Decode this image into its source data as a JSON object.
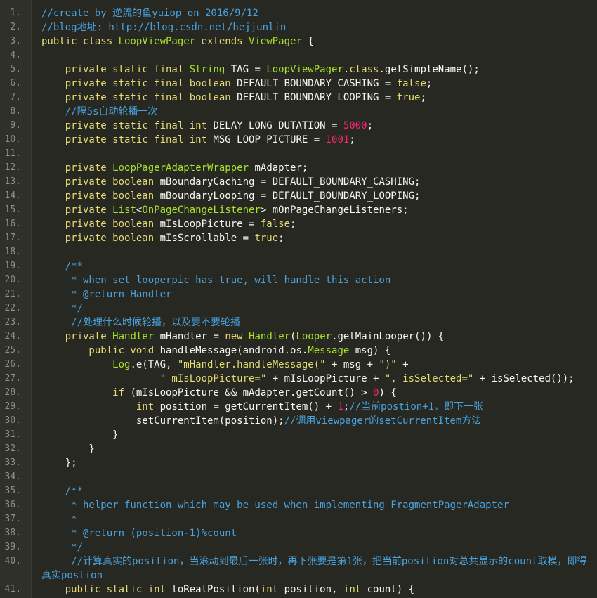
{
  "editor": {
    "theme_colors": {
      "background": "#272822",
      "gutter": "#2f302a",
      "comment": "#4aa3df",
      "keyword": "#e6db74",
      "type": "#a6e22e",
      "string": "#e6db74",
      "number": "#f92672",
      "plain": "#f8f8f2"
    },
    "lines": [
      {
        "n": "1.",
        "segs": [
          {
            "c": "comment",
            "t": "//create by 逆流的鱼yuiop on 2016/9/12"
          }
        ]
      },
      {
        "n": "2.",
        "segs": [
          {
            "c": "comment",
            "t": "//blog地址: http://blog.csdn.net/hejjunlin"
          }
        ]
      },
      {
        "n": "3.",
        "segs": [
          {
            "c": "kw",
            "t": "public class "
          },
          {
            "c": "ty",
            "t": "LoopViewPager"
          },
          {
            "c": "kw",
            "t": " extends "
          },
          {
            "c": "ty",
            "t": "ViewPager"
          },
          {
            "c": "pl",
            "t": " {"
          }
        ]
      },
      {
        "n": "4.",
        "segs": []
      },
      {
        "n": "5.",
        "segs": [
          {
            "c": "kw",
            "t": "    private static final "
          },
          {
            "c": "ty",
            "t": "String"
          },
          {
            "c": "pl",
            "t": " TAG = "
          },
          {
            "c": "ty",
            "t": "LoopViewPager"
          },
          {
            "c": "pl",
            "t": "."
          },
          {
            "c": "kw",
            "t": "class"
          },
          {
            "c": "pl",
            "t": ".getSimpleName();"
          }
        ]
      },
      {
        "n": "6.",
        "segs": [
          {
            "c": "kw",
            "t": "    private static final boolean"
          },
          {
            "c": "pl",
            "t": " DEFAULT_BOUNDARY_CASHING = "
          },
          {
            "c": "kw",
            "t": "false"
          },
          {
            "c": "pl",
            "t": ";"
          }
        ]
      },
      {
        "n": "7.",
        "segs": [
          {
            "c": "kw",
            "t": "    private static final boolean"
          },
          {
            "c": "pl",
            "t": " DEFAULT_BOUNDARY_LOOPING = "
          },
          {
            "c": "kw",
            "t": "true"
          },
          {
            "c": "pl",
            "t": ";"
          }
        ]
      },
      {
        "n": "8.",
        "segs": [
          {
            "c": "comment",
            "t": "    //隔5s自动轮播一次"
          }
        ]
      },
      {
        "n": "9.",
        "segs": [
          {
            "c": "kw",
            "t": "    private static final int"
          },
          {
            "c": "pl",
            "t": " DELAY_LONG_DUTATION = "
          },
          {
            "c": "num",
            "t": "5000"
          },
          {
            "c": "pl",
            "t": ";"
          }
        ]
      },
      {
        "n": "10.",
        "segs": [
          {
            "c": "kw",
            "t": "    private static final int"
          },
          {
            "c": "pl",
            "t": " MSG_LOOP_PICTURE = "
          },
          {
            "c": "num",
            "t": "1001"
          },
          {
            "c": "pl",
            "t": ";"
          }
        ]
      },
      {
        "n": "11.",
        "segs": []
      },
      {
        "n": "12.",
        "segs": [
          {
            "c": "kw",
            "t": "    private "
          },
          {
            "c": "ty",
            "t": "LoopPagerAdapterWrapper"
          },
          {
            "c": "pl",
            "t": " mAdapter;"
          }
        ]
      },
      {
        "n": "13.",
        "segs": [
          {
            "c": "kw",
            "t": "    private boolean"
          },
          {
            "c": "pl",
            "t": " mBoundaryCaching = DEFAULT_BOUNDARY_CASHING;"
          }
        ]
      },
      {
        "n": "14.",
        "segs": [
          {
            "c": "kw",
            "t": "    private boolean"
          },
          {
            "c": "pl",
            "t": " mBoundaryLooping = DEFAULT_BOUNDARY_LOOPING;"
          }
        ]
      },
      {
        "n": "15.",
        "segs": [
          {
            "c": "kw",
            "t": "    private "
          },
          {
            "c": "ty",
            "t": "List"
          },
          {
            "c": "pl",
            "t": "<"
          },
          {
            "c": "ty",
            "t": "OnPageChangeListener"
          },
          {
            "c": "pl",
            "t": "> mOnPageChangeListeners;"
          }
        ]
      },
      {
        "n": "16.",
        "segs": [
          {
            "c": "kw",
            "t": "    private boolean"
          },
          {
            "c": "pl",
            "t": " mIsLoopPicture = "
          },
          {
            "c": "kw",
            "t": "false"
          },
          {
            "c": "pl",
            "t": ";"
          }
        ]
      },
      {
        "n": "17.",
        "segs": [
          {
            "c": "kw",
            "t": "    private boolean"
          },
          {
            "c": "pl",
            "t": " mIsScrollable = "
          },
          {
            "c": "kw",
            "t": "true"
          },
          {
            "c": "pl",
            "t": ";"
          }
        ]
      },
      {
        "n": "18.",
        "segs": []
      },
      {
        "n": "19.",
        "segs": [
          {
            "c": "comment",
            "t": "    /**"
          }
        ]
      },
      {
        "n": "20.",
        "segs": [
          {
            "c": "comment",
            "t": "     * when set looperpic has true, will handle this action"
          }
        ]
      },
      {
        "n": "21.",
        "segs": [
          {
            "c": "comment",
            "t": "     * @return Handler"
          }
        ]
      },
      {
        "n": "22.",
        "segs": [
          {
            "c": "comment",
            "t": "     */"
          }
        ]
      },
      {
        "n": "23.",
        "segs": [
          {
            "c": "comment",
            "t": "     //处理什么时候轮播，以及要不要轮播"
          }
        ]
      },
      {
        "n": "24.",
        "segs": [
          {
            "c": "kw",
            "t": "    private "
          },
          {
            "c": "ty",
            "t": "Handler"
          },
          {
            "c": "pl",
            "t": " mHandler = "
          },
          {
            "c": "kw",
            "t": "new "
          },
          {
            "c": "ty",
            "t": "Handler"
          },
          {
            "c": "pl",
            "t": "("
          },
          {
            "c": "ty",
            "t": "Looper"
          },
          {
            "c": "pl",
            "t": ".getMainLooper()) {"
          }
        ]
      },
      {
        "n": "25.",
        "segs": [
          {
            "c": "kw",
            "t": "        public void"
          },
          {
            "c": "pl",
            "t": " handleMessage(android.os."
          },
          {
            "c": "ty",
            "t": "Message"
          },
          {
            "c": "pl",
            "t": " msg) {"
          }
        ]
      },
      {
        "n": "26.",
        "segs": [
          {
            "c": "ty",
            "t": "            Log"
          },
          {
            "c": "pl",
            "t": ".e(TAG, "
          },
          {
            "c": "str",
            "t": "\"mHandler.handleMessage(\""
          },
          {
            "c": "pl",
            "t": " + msg + "
          },
          {
            "c": "str",
            "t": "\")\""
          },
          {
            "c": "pl",
            "t": " +"
          }
        ]
      },
      {
        "n": "27.",
        "segs": [
          {
            "c": "str",
            "t": "                    \" mIsLoopPicture=\""
          },
          {
            "c": "pl",
            "t": " + mIsLoopPicture + "
          },
          {
            "c": "str",
            "t": "\", isSelected=\""
          },
          {
            "c": "pl",
            "t": " + isSelected());"
          }
        ]
      },
      {
        "n": "28.",
        "segs": [
          {
            "c": "kw",
            "t": "            if"
          },
          {
            "c": "pl",
            "t": " (mIsLoopPicture && mAdapter.getCount() > "
          },
          {
            "c": "num",
            "t": "0"
          },
          {
            "c": "pl",
            "t": ") {"
          }
        ]
      },
      {
        "n": "29.",
        "segs": [
          {
            "c": "kw",
            "t": "                int"
          },
          {
            "c": "pl",
            "t": " position = getCurrentItem() + "
          },
          {
            "c": "num",
            "t": "1"
          },
          {
            "c": "pl",
            "t": ";"
          },
          {
            "c": "comment",
            "t": "//当前postion+1，即下一张"
          }
        ]
      },
      {
        "n": "30.",
        "segs": [
          {
            "c": "pl",
            "t": "                setCurrentItem(position);"
          },
          {
            "c": "comment",
            "t": "//调用viewpager的setCurrentItem方法"
          }
        ]
      },
      {
        "n": "31.",
        "segs": [
          {
            "c": "pl",
            "t": "            }"
          }
        ]
      },
      {
        "n": "32.",
        "segs": [
          {
            "c": "pl",
            "t": "        }"
          }
        ]
      },
      {
        "n": "33.",
        "segs": [
          {
            "c": "pl",
            "t": "    };"
          }
        ]
      },
      {
        "n": "34.",
        "segs": []
      },
      {
        "n": "35.",
        "segs": [
          {
            "c": "comment",
            "t": "    /**"
          }
        ]
      },
      {
        "n": "36.",
        "segs": [
          {
            "c": "comment",
            "t": "     * helper function which may be used when implementing FragmentPagerAdapter"
          }
        ]
      },
      {
        "n": "37.",
        "segs": [
          {
            "c": "comment",
            "t": "     *"
          }
        ]
      },
      {
        "n": "38.",
        "segs": [
          {
            "c": "comment",
            "t": "     * @return (position-1)%count"
          }
        ]
      },
      {
        "n": "39.",
        "segs": [
          {
            "c": "comment",
            "t": "     */"
          }
        ]
      },
      {
        "n": "40.",
        "wrap": true,
        "segs": [
          {
            "c": "comment",
            "t": "     //计算真实的position，当滚动到最后一张时，再下张要是第1张，把当前position对总共显示的count取模，即得真实postion"
          }
        ]
      },
      {
        "n": "41.",
        "segs": [
          {
            "c": "kw",
            "t": "    public static int"
          },
          {
            "c": "pl",
            "t": " toRealPosition("
          },
          {
            "c": "kw",
            "t": "int"
          },
          {
            "c": "pl",
            "t": " position, "
          },
          {
            "c": "kw",
            "t": "int"
          },
          {
            "c": "pl",
            "t": " count) {"
          }
        ]
      }
    ]
  }
}
